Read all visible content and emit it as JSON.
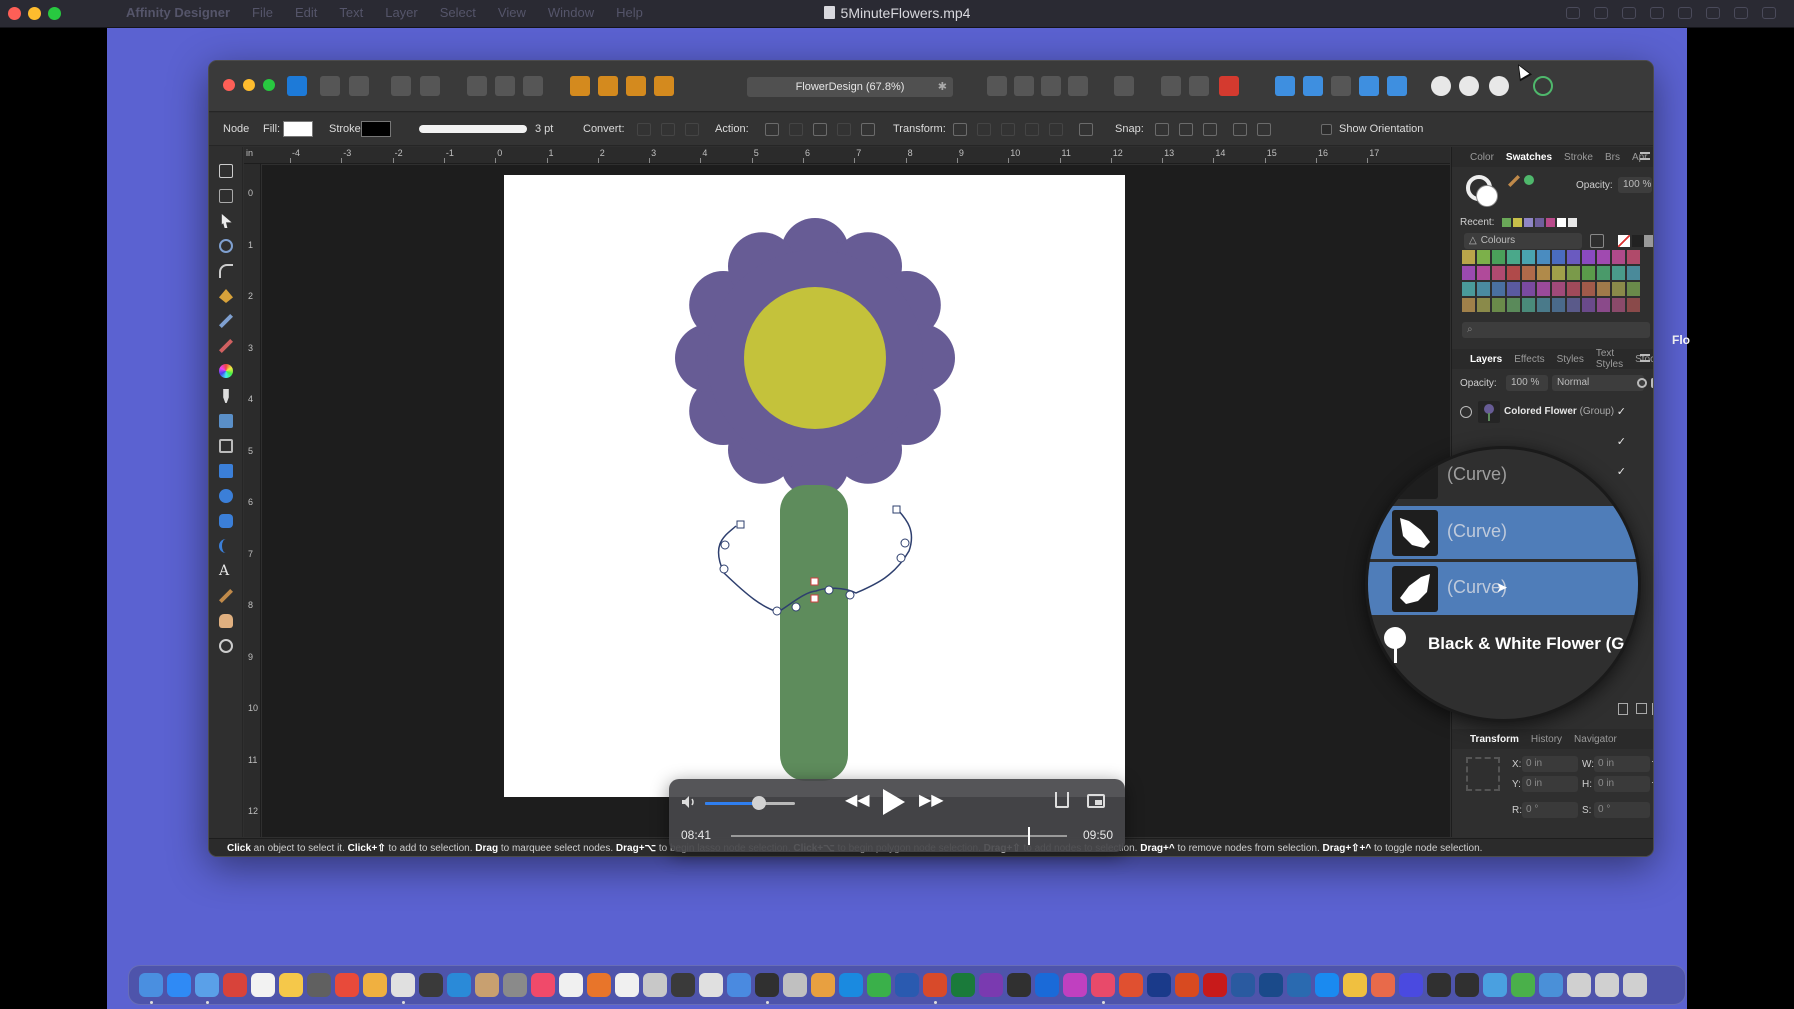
{
  "player": {
    "title": "5MinuteFlowers.mp4",
    "time_current": "08:41",
    "time_total": "09:50",
    "progress": 0.883,
    "volume": 0.6
  },
  "ghost_menubar": {
    "app": "Affinity Designer",
    "items": [
      "File",
      "Edit",
      "Text",
      "Layer",
      "Select",
      "View",
      "Window",
      "Help"
    ]
  },
  "affinity": {
    "doc_title": "FlowerDesign (67.8%)",
    "context": {
      "node_label": "Node",
      "fill_label": "Fill:",
      "stroke_label": "Stroke",
      "stroke_width": "3 pt",
      "convert_label": "Convert:",
      "action_label": "Action:",
      "transform_label": "Transform:",
      "snap_label": "Snap:",
      "show_orientation": "Show Orientation"
    },
    "ruler_top": [
      "-4",
      "-3",
      "-2",
      "-1",
      "0",
      "1",
      "2",
      "3",
      "4",
      "5",
      "6",
      "7",
      "8",
      "9",
      "10",
      "11",
      "12",
      "13",
      "14",
      "15",
      "16",
      "17"
    ],
    "ruler_unit": "in",
    "ruler_left": [
      "0",
      "1",
      "2",
      "3",
      "4",
      "5",
      "6",
      "7",
      "8",
      "9",
      "10",
      "11",
      "12"
    ],
    "swatches_panel": {
      "tabs": [
        "Color",
        "Swatches",
        "Stroke",
        "Brs",
        "Apr"
      ],
      "active_tab": "Swatches",
      "opacity_label": "Opacity:",
      "opacity_value": "100 %",
      "recent_label": "Recent:",
      "palette_name": "Colours",
      "recent_colors": [
        "#6aa858",
        "#c8c04a",
        "#8f86c6",
        "#6f5f9c",
        "#b84a8a",
        "#ffffff",
        "#e8e8e8"
      ],
      "palette_colors": [
        "#b9a54a",
        "#7cb04a",
        "#4aa05a",
        "#4aa88a",
        "#4aa4b0",
        "#4a8cc0",
        "#4a6cc0",
        "#6a5ac0",
        "#8a4ac0",
        "#a04ab0",
        "#b04a8a",
        "#b04a6a",
        "#9a4ab0",
        "#b04a9a",
        "#b04a70",
        "#b04a4a",
        "#b06a4a",
        "#b08a4a",
        "#a0a04a",
        "#7a9a4a",
        "#5a9a4a",
        "#4a9a6a",
        "#4a9a8a",
        "#4a8a9a",
        "#4a9a9a",
        "#4a8aa0",
        "#4a70a0",
        "#5a5aa0",
        "#7a4aa0",
        "#9a4a9a",
        "#a04a7a",
        "#a04a5a",
        "#a05a4a",
        "#a07a4a",
        "#8a8a4a",
        "#6a8a4a",
        "#a0804a",
        "#8a8a4a",
        "#6a8a4a",
        "#5a8a5a",
        "#4a8a7a",
        "#4a7a8a",
        "#4a6a8a",
        "#5a5a8a",
        "#6a4a8a",
        "#8a4a8a",
        "#8a4a6a",
        "#8a4a4a"
      ]
    },
    "layers_panel": {
      "tabs": [
        "Layers",
        "Effects",
        "Styles",
        "Text Styles",
        "Stock"
      ],
      "active_tab": "Layers",
      "opacity_label": "Opacity:",
      "opacity_value": "100 %",
      "blend_mode": "Normal",
      "group_name": "Colored Flower",
      "group_suffix": "(Group)"
    },
    "loupe_rows": [
      {
        "label": "(Curve)",
        "selected": false
      },
      {
        "label": "(Curve)",
        "selected": true
      },
      {
        "label": "(Curve)",
        "selected": true
      },
      {
        "label": "Black & White Flower (G",
        "selected": false
      }
    ],
    "transform_panel": {
      "tabs": [
        "Transform",
        "History",
        "Navigator"
      ],
      "active_tab": "Transform",
      "fields": [
        {
          "label": "X:",
          "value": "0 in"
        },
        {
          "label": "W:",
          "value": "0 in"
        },
        {
          "label": "Y:",
          "value": "0 in"
        },
        {
          "label": "H:",
          "value": "0 in"
        },
        {
          "label": "R:",
          "value": "0 °"
        },
        {
          "label": "S:",
          "value": "0 °"
        }
      ]
    },
    "status_bar": {
      "parts": [
        {
          "bold": "Click",
          "text": " an object to select it. "
        },
        {
          "bold": "Click+⇧",
          "text": " to add to selection. "
        },
        {
          "bold": "Drag",
          "text": " to marquee select nodes. "
        },
        {
          "bold": "Drag+⌥",
          "text": " to begin lasso node selection. "
        },
        {
          "bold": "Click+⌥",
          "text": " to begin polygon node selection. "
        },
        {
          "bold": "Drag+⇧",
          "text": " to add nodes to selection. "
        },
        {
          "bold": "Drag+^",
          "text": " to remove nodes from selection. "
        },
        {
          "bold": "Drag+⇧+^",
          "text": " to toggle node selection."
        }
      ]
    }
  },
  "desktop_peek_text": "Flo",
  "artwork_colors": {
    "petals": "#675c95",
    "center": "#c4c23b",
    "stem": "#5e8c5c",
    "path": "#2e3f6e"
  }
}
